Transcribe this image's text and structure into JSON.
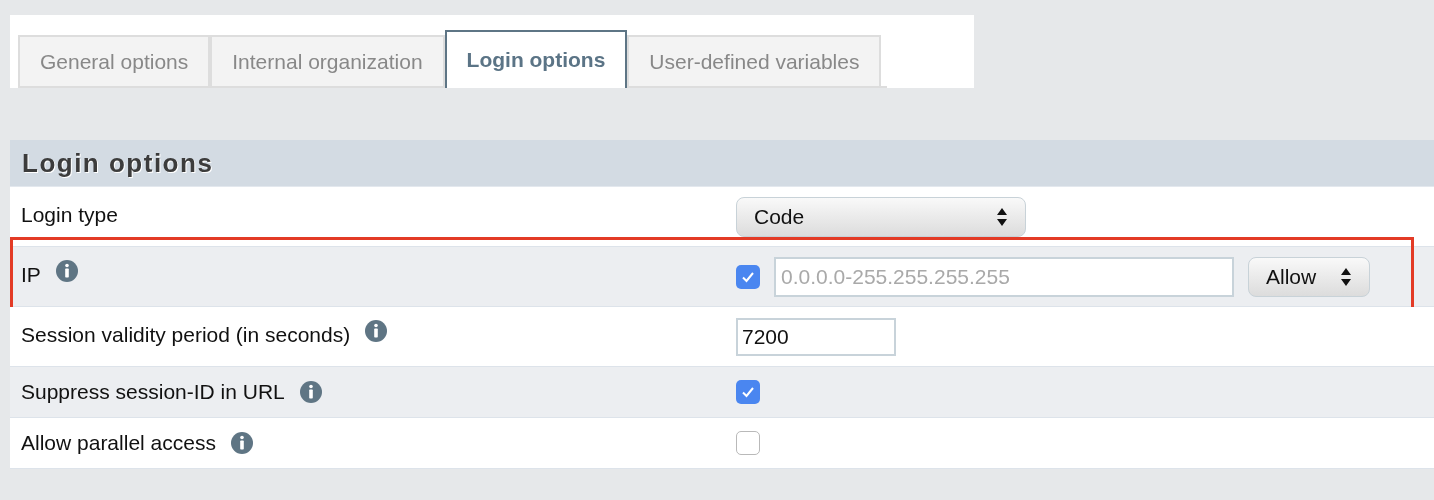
{
  "tabs": [
    {
      "label": "General options",
      "selected": false
    },
    {
      "label": "Internal organization",
      "selected": false
    },
    {
      "label": "Login options",
      "selected": true
    },
    {
      "label": "User-defined variables",
      "selected": false
    }
  ],
  "section": {
    "title": "Login options"
  },
  "rows": [
    {
      "kind": "select",
      "label": "Login type",
      "info": false,
      "highlighted": false,
      "value": "Code"
    },
    {
      "kind": "ip",
      "label": "IP",
      "info": true,
      "highlighted": true,
      "checked": true,
      "placeholder": "0.0.0.0-255.255.255.255",
      "mode": "Allow"
    },
    {
      "kind": "text",
      "label": "Session validity period (in seconds)",
      "info": true,
      "highlighted": false,
      "value": "7200"
    },
    {
      "kind": "checkbox",
      "label": "Suppress session-ID in URL",
      "info": true,
      "highlighted": false,
      "checked": true
    },
    {
      "kind": "checkbox",
      "label": "Allow parallel access",
      "info": true,
      "highlighted": false,
      "checked": false
    }
  ]
}
